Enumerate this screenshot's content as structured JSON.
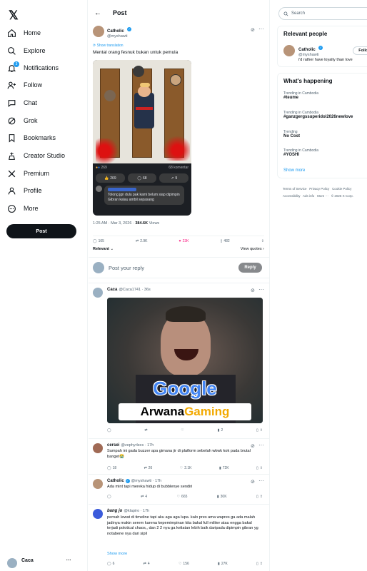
{
  "nav": {
    "items": [
      {
        "label": "Home",
        "icon": "home-icon"
      },
      {
        "label": "Explore",
        "icon": "search-icon"
      },
      {
        "label": "Notifications",
        "icon": "bell-icon",
        "badge": "3"
      },
      {
        "label": "Follow",
        "icon": "person-add-icon"
      },
      {
        "label": "Chat",
        "icon": "chat-icon"
      },
      {
        "label": "Grok",
        "icon": "grok-icon"
      },
      {
        "label": "Bookmarks",
        "icon": "bookmark-icon"
      },
      {
        "label": "Creator Studio",
        "icon": "creator-studio-icon"
      },
      {
        "label": "Premium",
        "icon": "x-logo-icon"
      },
      {
        "label": "Profile",
        "icon": "person-icon"
      },
      {
        "label": "More",
        "icon": "more-circle-icon"
      }
    ],
    "post_label": "Post",
    "account_name": "Caca"
  },
  "header": {
    "title": "Post"
  },
  "tweet": {
    "author_name": "Catholic",
    "author_handle": "@myshawti",
    "show_translation": "Show translation",
    "text": "Mental orang fesnuk bukan untuk pemula",
    "embed": {
      "reactions_count": "269",
      "comments_label": "68 komentar",
      "likes": "269",
      "comments": "68",
      "shares": "9",
      "comment_text": "Tolong jgn dulu pak kami belum siap dipimpin Gibran kalau ambil sepasang"
    },
    "time": "1:25 AM · Mar 3, 2026",
    "views_count": "384.6K",
    "views_label": "Views",
    "stats": {
      "replies": "165",
      "retweets": "2.9K",
      "likes": "23K",
      "bookmarks": "482"
    },
    "relevant_label": "Relevant",
    "view_quotes_label": "View quotes"
  },
  "reply_box": {
    "placeholder": "Post your reply",
    "button": "Reply"
  },
  "replies": [
    {
      "name": "Caca",
      "handle": "@Caca1741 · 36s",
      "text": "",
      "stats": {
        "replies": "",
        "retweets": "",
        "likes": "",
        "views": "2"
      },
      "image_text": {
        "line1": "Google",
        "line2a": "Arwana",
        "line2b": "Gaming"
      }
    },
    {
      "name": "cersei",
      "handle": "@zephyrlzes · 17h",
      "text": "Sumpah ini gada buzzer apa gimana jir di platform sebelah wkwk kok pada brutal banget😭",
      "stats": {
        "replies": "18",
        "retweets": "26",
        "likes": "2.1K",
        "views": "72K"
      }
    },
    {
      "name": "Catholic",
      "handle": "@myshawti · 17h",
      "text": "Ada mint tapi mereka hidup di bubblenye sendiri",
      "stats": {
        "replies": "",
        "retweets": "4",
        "likes": "665",
        "views": "30K"
      }
    },
    {
      "name": "bang jo",
      "handle": "@klapiro · 17h",
      "text": "pernah lewat di timeline tapi aku aga aga lupa. kalo pres ama wapres ga ada malah jadinya makin serem karena kepemimpinan kita bakal full militer atau engga bakal terjadi polotical chaos,, dan 2 2 nya ga keliatan lebih baik daripada dipimpin gibran yg notabene nya dari sipil",
      "show_more": "Show more",
      "stats": {
        "replies": "6",
        "retweets": "4",
        "likes": "156",
        "views": "27K"
      }
    }
  ],
  "right": {
    "search_placeholder": "Search",
    "relevant_title": "Relevant people",
    "relevant_person": {
      "name": "Catholic",
      "handle": "@myshawti",
      "bio": "i'd rather have loyalty than love",
      "follow_label": "Follow"
    },
    "happening_title": "What's happening",
    "trends": [
      {
        "category": "Trending in Cambodia",
        "name": "#teume"
      },
      {
        "category": "Trending in Cambodia",
        "name": "#ganzgergssuperidol2026newlove"
      },
      {
        "category": "Trending",
        "name": "No Cost"
      },
      {
        "category": "Trending in Cambodia",
        "name": "#YOSHI"
      }
    ],
    "show_more": "Show more",
    "footer": [
      "Terms of Service",
      "Privacy Policy",
      "Cookie Policy",
      "Accessibility",
      "Ads info",
      "More ···",
      "© 2026 X Corp."
    ]
  },
  "colors": {
    "accent": "#1d9bf0",
    "like": "#f91880",
    "text": "#0f1419",
    "muted": "#536471"
  }
}
